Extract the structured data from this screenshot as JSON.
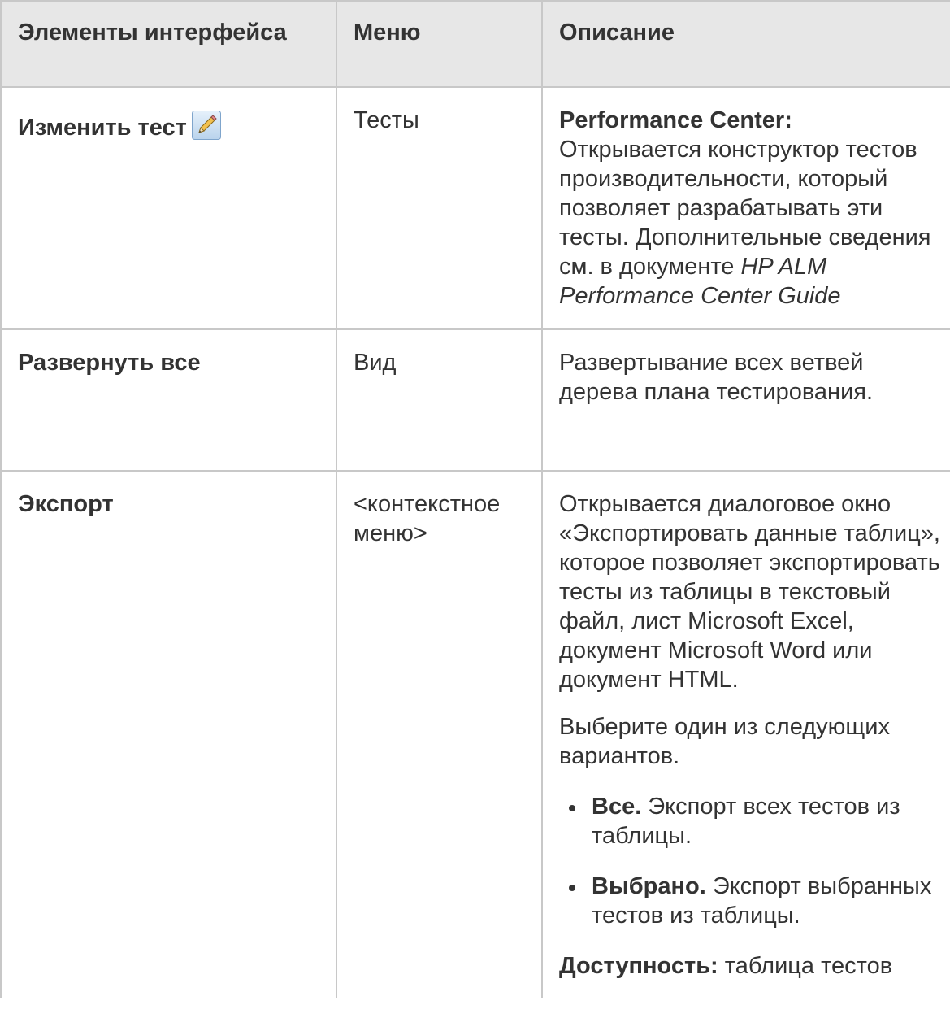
{
  "table": {
    "headers": [
      "Элементы интерфейса",
      "Меню",
      "Описание"
    ],
    "rows": [
      {
        "element": "Изменить тест",
        "element_icon": "pencil-icon",
        "menu": "Тесты",
        "desc_bold": "Performance Center:",
        "desc_text": "Открывается конструктор тестов производительности, который позволяет разрабатывать эти тесты. Дополнительные сведения см. в документе ",
        "desc_italic": "HP ALM Performance Center Guide"
      },
      {
        "element": "Развернуть все",
        "menu": "Вид",
        "desc_text": "Развертывание всех ветвей дерева плана тестирования."
      },
      {
        "element": "Экспорт",
        "menu": "<контекстное меню>",
        "desc_text": "Открывается диалоговое окно «Экспортировать данные таблиц», которое позволяет экспортировать тесты из таблицы в текстовый файл, лист Microsoft Excel, документ Microsoft Word или документ HTML.",
        "desc_text2": "Выберите один из следующих вариантов.",
        "options": [
          {
            "label": "Все.",
            "text": " Экспорт всех тестов из таблицы."
          },
          {
            "label": "Выбрано.",
            "text": " Экспорт выбранных тестов из таблицы."
          }
        ],
        "availability_label": "Доступность:",
        "availability_text": " таблица тестов"
      }
    ]
  }
}
